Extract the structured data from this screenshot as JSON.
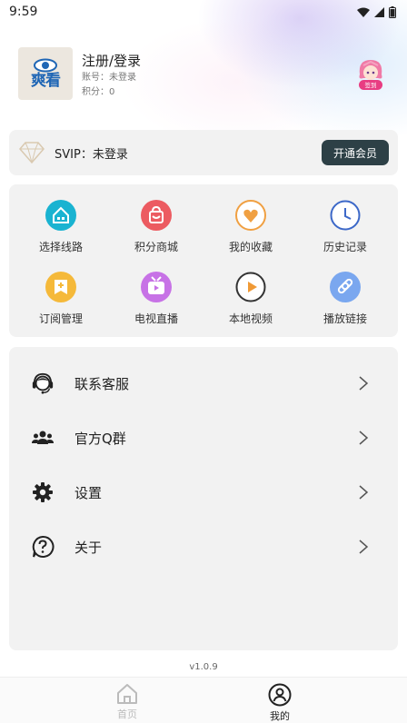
{
  "status_bar": {
    "time": "9:59"
  },
  "profile": {
    "logo_text": "爽看",
    "title": "注册/登录",
    "account_line": "账号：未登录",
    "points_line": "积分：0",
    "avatar_badge": "签到"
  },
  "vip": {
    "label": "SVIP：未登录",
    "button": "开通会员"
  },
  "features": [
    {
      "label": "选择线路",
      "icon": "route-icon",
      "color": "#1ab3d1"
    },
    {
      "label": "积分商城",
      "icon": "shop-bag-icon",
      "color": "#ec5b61"
    },
    {
      "label": "我的收藏",
      "icon": "heart-icon",
      "color": "#f0a042"
    },
    {
      "label": "历史记录",
      "icon": "clock-icon",
      "color": "#3c68c8"
    },
    {
      "label": "订阅管理",
      "icon": "subscribe-icon",
      "color": "#f5b93a"
    },
    {
      "label": "电视直播",
      "icon": "tv-icon",
      "color": "#c772e6"
    },
    {
      "label": "本地视频",
      "icon": "play-icon",
      "color": "#f09a36"
    },
    {
      "label": "播放链接",
      "icon": "link-icon",
      "color": "#7aa7ef"
    }
  ],
  "menu": [
    {
      "label": "联系客服",
      "icon": "headset-icon"
    },
    {
      "label": "官方Q群",
      "icon": "group-icon"
    },
    {
      "label": "设置",
      "icon": "gear-icon"
    },
    {
      "label": "关于",
      "icon": "help-icon"
    }
  ],
  "version": "v1.0.9",
  "tabs": [
    {
      "label": "首页",
      "icon": "home-icon",
      "active": false
    },
    {
      "label": "我的",
      "icon": "user-icon",
      "active": true
    }
  ],
  "colors": {
    "vip_button": "#2d4046",
    "card_bg": "#f2f2f2",
    "tab_inactive": "#bbbbbb",
    "tab_active": "#222222"
  }
}
